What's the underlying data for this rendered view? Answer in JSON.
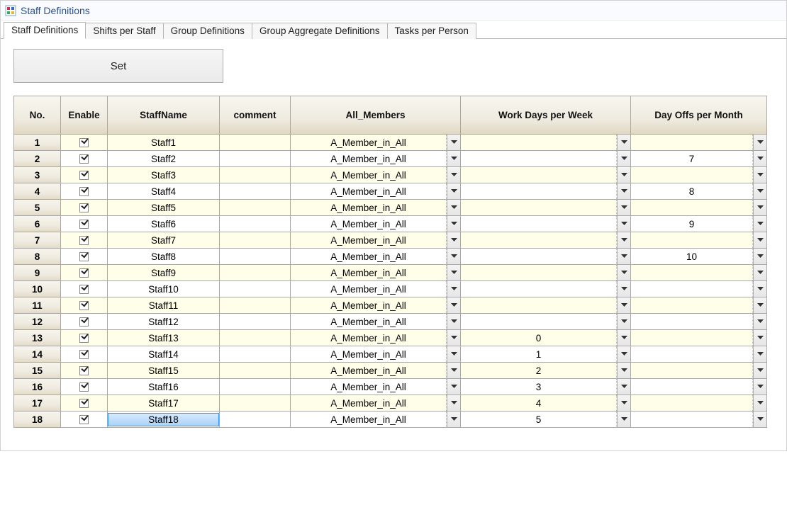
{
  "window": {
    "title": "Staff Definitions"
  },
  "tabs": [
    {
      "label": "Staff Definitions",
      "active": true
    },
    {
      "label": "Shifts per Staff",
      "active": false
    },
    {
      "label": "Group Definitions",
      "active": false
    },
    {
      "label": "Group Aggregate Definitions",
      "active": false
    },
    {
      "label": "Tasks per Person",
      "active": false
    }
  ],
  "buttons": {
    "set_label": "Set"
  },
  "table": {
    "headers": {
      "no": "No.",
      "enable": "Enable",
      "staff_name": "StaffName",
      "comment": "comment",
      "all_members": "All_Members",
      "work_days_per_week": "Work Days per Week",
      "day_offs_per_month": "Day Offs per Month"
    },
    "rows": [
      {
        "no": "1",
        "enable": true,
        "staff_name": "Staff1",
        "comment": "",
        "all_members": "A_Member_in_All",
        "work_days_per_week": "",
        "day_offs_per_month": ""
      },
      {
        "no": "2",
        "enable": true,
        "staff_name": "Staff2",
        "comment": "",
        "all_members": "A_Member_in_All",
        "work_days_per_week": "",
        "day_offs_per_month": "7"
      },
      {
        "no": "3",
        "enable": true,
        "staff_name": "Staff3",
        "comment": "",
        "all_members": "A_Member_in_All",
        "work_days_per_week": "",
        "day_offs_per_month": ""
      },
      {
        "no": "4",
        "enable": true,
        "staff_name": "Staff4",
        "comment": "",
        "all_members": "A_Member_in_All",
        "work_days_per_week": "",
        "day_offs_per_month": "8"
      },
      {
        "no": "5",
        "enable": true,
        "staff_name": "Staff5",
        "comment": "",
        "all_members": "A_Member_in_All",
        "work_days_per_week": "",
        "day_offs_per_month": ""
      },
      {
        "no": "6",
        "enable": true,
        "staff_name": "Staff6",
        "comment": "",
        "all_members": "A_Member_in_All",
        "work_days_per_week": "",
        "day_offs_per_month": "9"
      },
      {
        "no": "7",
        "enable": true,
        "staff_name": "Staff7",
        "comment": "",
        "all_members": "A_Member_in_All",
        "work_days_per_week": "",
        "day_offs_per_month": ""
      },
      {
        "no": "8",
        "enable": true,
        "staff_name": "Staff8",
        "comment": "",
        "all_members": "A_Member_in_All",
        "work_days_per_week": "",
        "day_offs_per_month": "10"
      },
      {
        "no": "9",
        "enable": true,
        "staff_name": "Staff9",
        "comment": "",
        "all_members": "A_Member_in_All",
        "work_days_per_week": "",
        "day_offs_per_month": ""
      },
      {
        "no": "10",
        "enable": true,
        "staff_name": "Staff10",
        "comment": "",
        "all_members": "A_Member_in_All",
        "work_days_per_week": "",
        "day_offs_per_month": ""
      },
      {
        "no": "11",
        "enable": true,
        "staff_name": "Staff11",
        "comment": "",
        "all_members": "A_Member_in_All",
        "work_days_per_week": "",
        "day_offs_per_month": ""
      },
      {
        "no": "12",
        "enable": true,
        "staff_name": "Staff12",
        "comment": "",
        "all_members": "A_Member_in_All",
        "work_days_per_week": "",
        "day_offs_per_month": ""
      },
      {
        "no": "13",
        "enable": true,
        "staff_name": "Staff13",
        "comment": "",
        "all_members": "A_Member_in_All",
        "work_days_per_week": "0",
        "day_offs_per_month": ""
      },
      {
        "no": "14",
        "enable": true,
        "staff_name": "Staff14",
        "comment": "",
        "all_members": "A_Member_in_All",
        "work_days_per_week": "1",
        "day_offs_per_month": ""
      },
      {
        "no": "15",
        "enable": true,
        "staff_name": "Staff15",
        "comment": "",
        "all_members": "A_Member_in_All",
        "work_days_per_week": "2",
        "day_offs_per_month": ""
      },
      {
        "no": "16",
        "enable": true,
        "staff_name": "Staff16",
        "comment": "",
        "all_members": "A_Member_in_All",
        "work_days_per_week": "3",
        "day_offs_per_month": ""
      },
      {
        "no": "17",
        "enable": true,
        "staff_name": "Staff17",
        "comment": "",
        "all_members": "A_Member_in_All",
        "work_days_per_week": "4",
        "day_offs_per_month": ""
      },
      {
        "no": "18",
        "enable": true,
        "staff_name": "Staff18",
        "comment": "",
        "all_members": "A_Member_in_All",
        "work_days_per_week": "5",
        "day_offs_per_month": "",
        "selected_cell": "staff_name"
      }
    ]
  }
}
